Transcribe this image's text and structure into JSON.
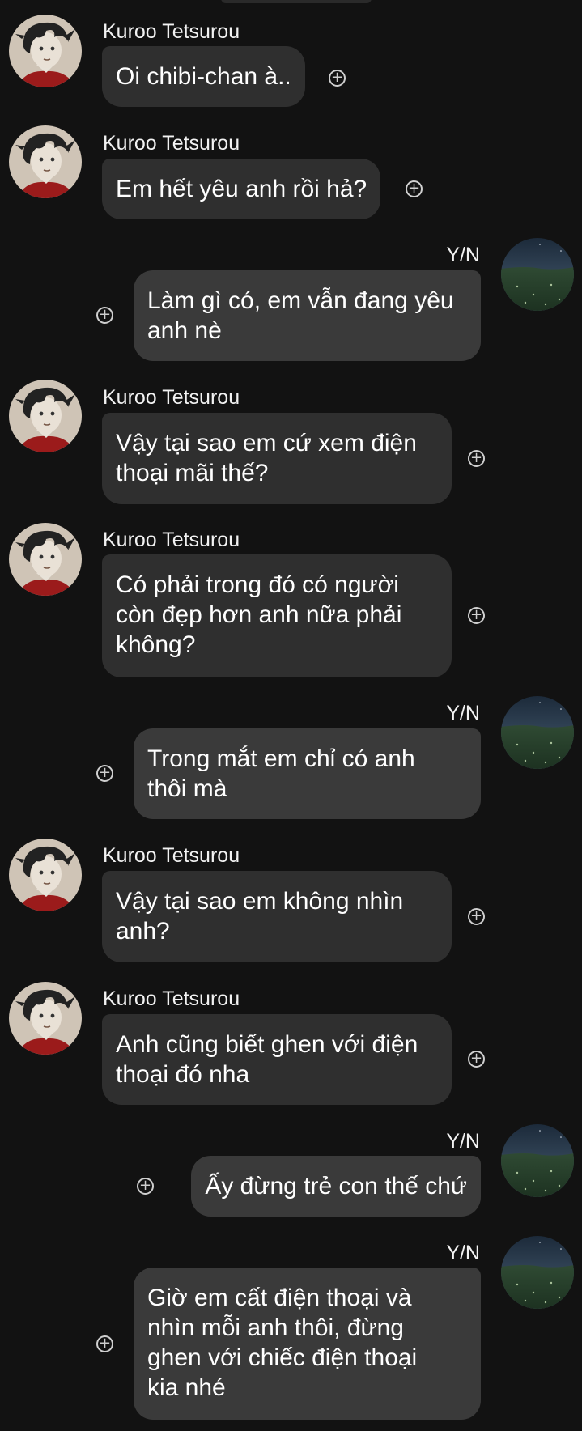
{
  "colors": {
    "background": "#121212",
    "bubble_incoming": "#2f2f2f",
    "bubble_outgoing": "#3a3a3a",
    "text": "#ffffff"
  },
  "icons": {
    "react": "add-reaction-icon",
    "contact_avatar": "kuroo-avatar",
    "self_avatar": "landscape-avatar"
  },
  "conversation": {
    "messages": [
      {
        "side": "left",
        "sender": "Kuroo Tetsurou",
        "text": "Oi chibi-chan à.."
      },
      {
        "side": "left",
        "sender": "Kuroo Tetsurou",
        "text": "Em hết yêu anh rồi hả?"
      },
      {
        "side": "right",
        "sender": "Y/N",
        "text": "Làm gì có, em vẫn đang yêu\nanh nè"
      },
      {
        "side": "left",
        "sender": "Kuroo Tetsurou",
        "text": "Vậy tại sao em cứ xem điện\nthoại mãi thế?"
      },
      {
        "side": "left",
        "sender": "Kuroo Tetsurou",
        "text": "Có phải trong đó có người\ncòn đẹp hơn anh nữa phải\nkhông?"
      },
      {
        "side": "right",
        "sender": "Y/N",
        "text": "Trong mắt em chỉ có anh\nthôi mà"
      },
      {
        "side": "left",
        "sender": "Kuroo Tetsurou",
        "text": "Vậy tại sao em không nhìn\nanh?"
      },
      {
        "side": "left",
        "sender": "Kuroo Tetsurou",
        "text": "Anh cũng biết ghen với điện\nthoại đó nha"
      },
      {
        "side": "right",
        "sender": "Y/N",
        "text": "Ấy đừng trẻ con thế chứ"
      },
      {
        "side": "right",
        "sender": "Y/N",
        "text": "Giờ em cất điện thoại và\nnhìn mỗi anh thôi, đừng\nghen với chiếc điện thoại\nkia nhé"
      }
    ]
  }
}
